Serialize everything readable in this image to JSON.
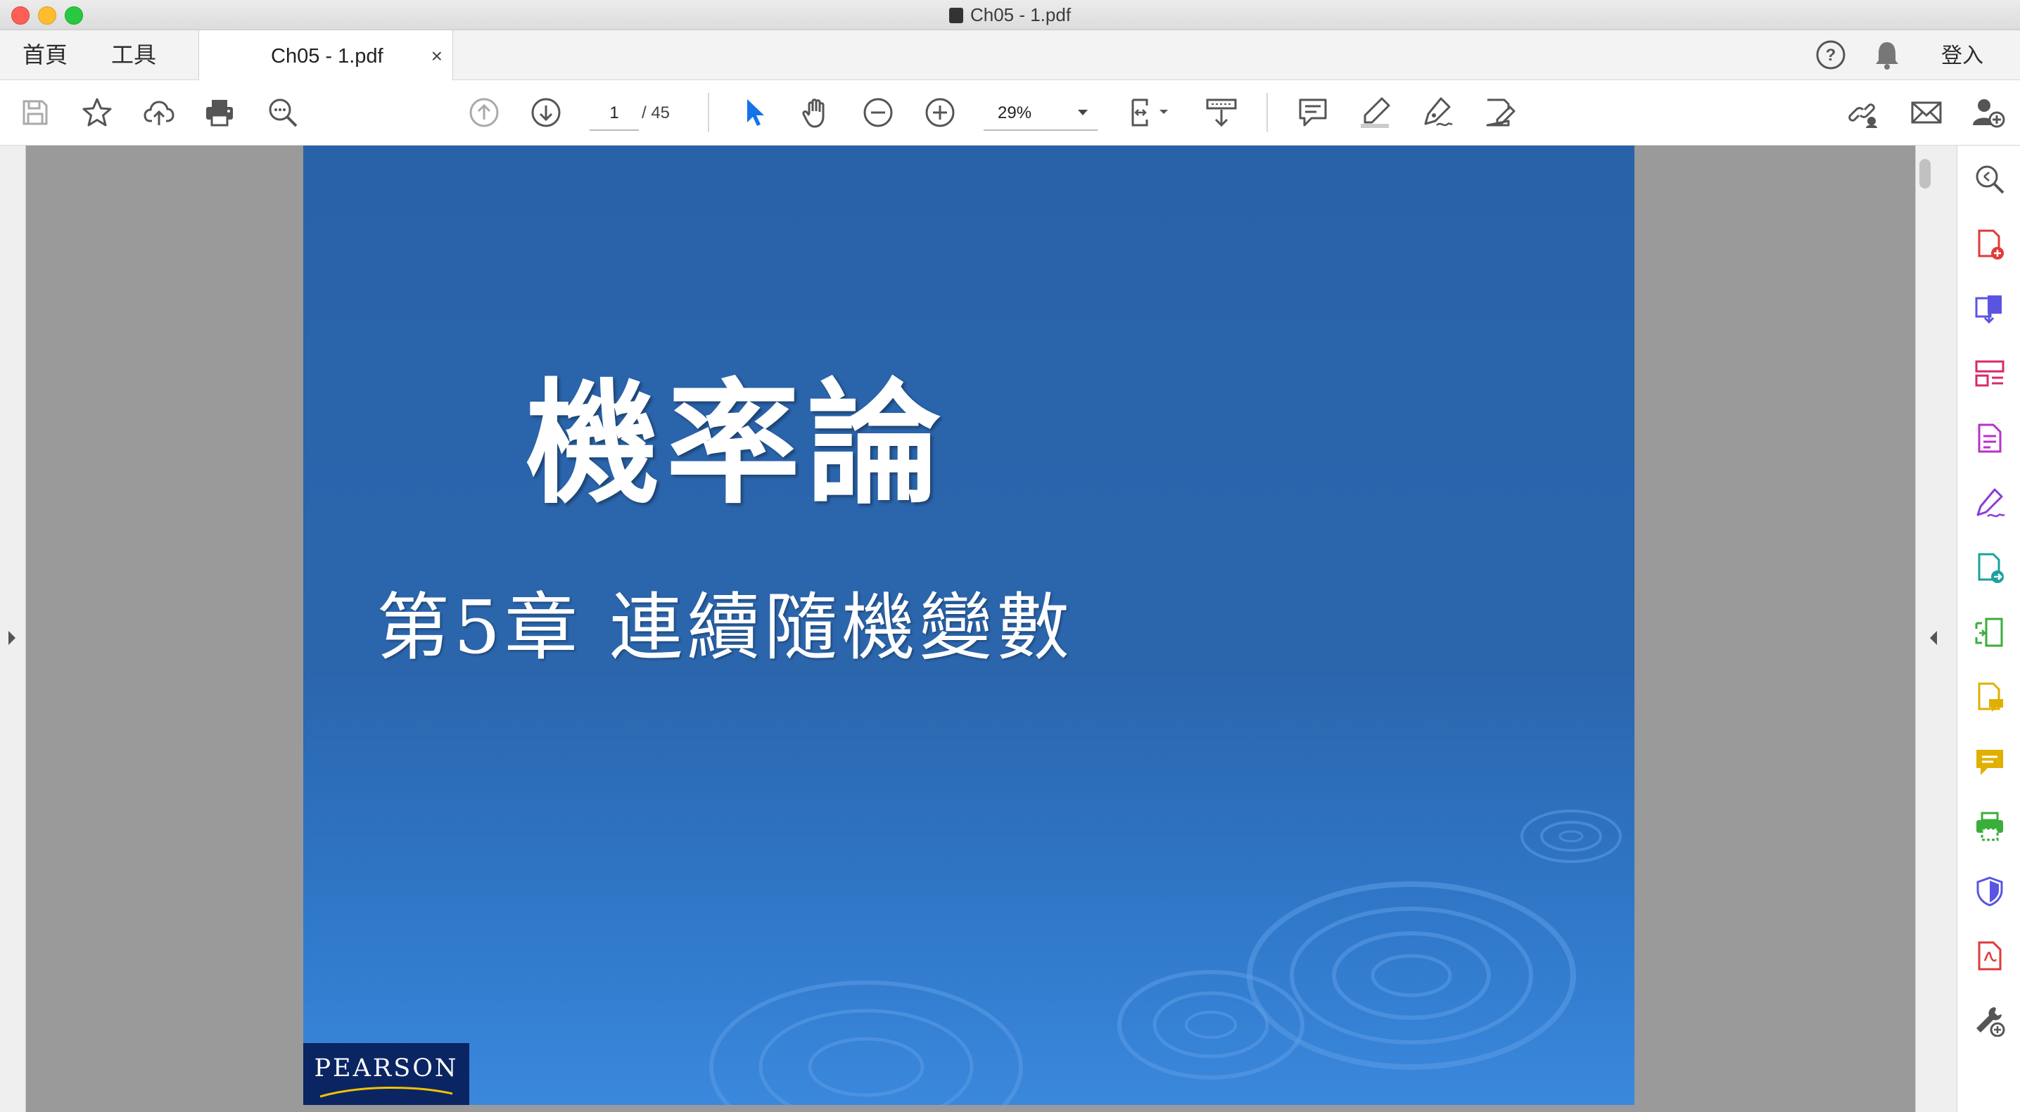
{
  "window": {
    "title": "Ch05 - 1.pdf"
  },
  "tabs": {
    "home": "首頁",
    "tools": "工具",
    "document": "Ch05 - 1.pdf",
    "close_glyph": "×"
  },
  "header": {
    "login": "登入",
    "help_icon": "help-circle-icon",
    "bell_icon": "bell-icon"
  },
  "toolbar": {
    "page_current": "1",
    "page_total": "/ 45",
    "zoom": "29%",
    "icons": [
      "save-icon",
      "bookmark-star-icon",
      "upload-cloud-icon",
      "print-icon",
      "find-zoom-icon",
      "prev-page-icon",
      "next-page-icon",
      "select-arrow-icon",
      "hand-icon",
      "zoom-out-icon",
      "zoom-in-icon",
      "fit-page-icon",
      "scroll-mode-icon",
      "comment-icon",
      "highlight-icon",
      "sign-icon",
      "edit-icon",
      "share-link-icon",
      "email-icon",
      "add-user-icon"
    ]
  },
  "document": {
    "title": "機率論",
    "subtitle": "第5章  連續隨機變數",
    "publisher": "PEARSON"
  },
  "side_panel": {
    "tools": [
      "search-zoom-icon",
      "create-pdf-icon",
      "combine-files-icon",
      "organize-pages-icon",
      "edit-pdf-icon",
      "fill-sign-icon",
      "export-pdf-icon",
      "scan-icon",
      "comment-tool-icon",
      "send-comments-icon",
      "print-production-icon",
      "protect-icon",
      "compare-icon",
      "more-tools-icon"
    ],
    "colors": [
      "#e03a3a",
      "#d8264f",
      "#5a55e0",
      "#d9286d",
      "#b832c9",
      "#8a3cd8",
      "#17a39c",
      "#3aae3a",
      "#e0b000",
      "#e0b000",
      "#3aae3a",
      "#5a55e0",
      "#e03a3a",
      "#555555"
    ]
  }
}
